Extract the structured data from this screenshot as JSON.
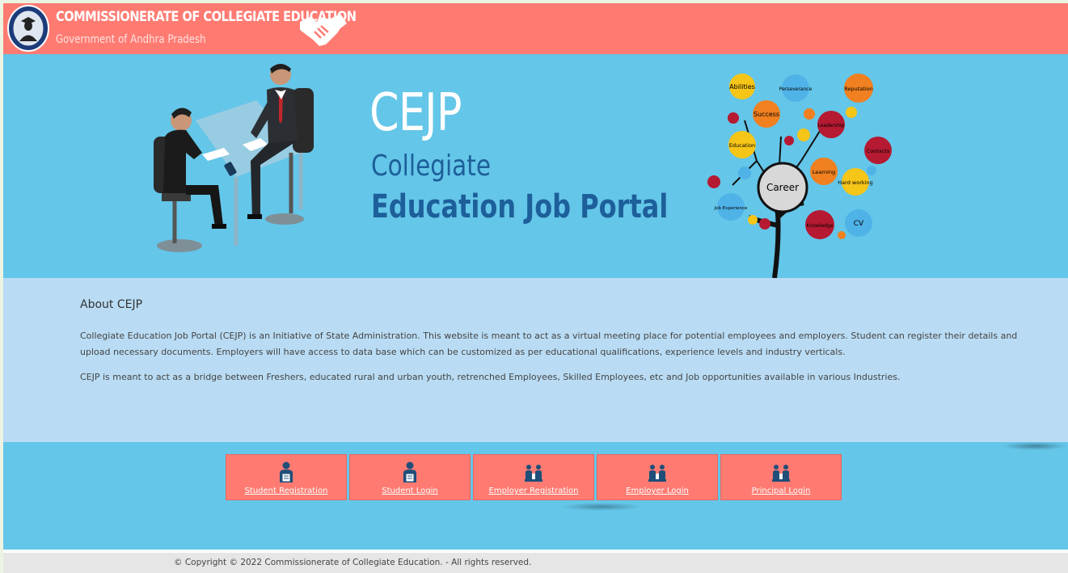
{
  "header": {
    "org_name": "COMMISSIONERATE OF COLLEGIATE EDUCATION",
    "org_subtitle": "Government of Andhra Pradesh"
  },
  "banner": {
    "title": "CEJP",
    "subtitle_line1": "Collegiate",
    "subtitle_line2": "Education Job Portal",
    "tree_words": [
      "Abilities",
      "Perseverance",
      "Reputation",
      "Success",
      "Leadership",
      "Education",
      "Contacts",
      "Career",
      "Learning",
      "Hard working",
      "Job Experience",
      "Knowledge",
      "CV"
    ]
  },
  "about": {
    "heading": "About CEJP",
    "paragraph1": "Collegiate Education Job Portal (CEJP) is an Initiative of State Administration. This website is meant to act as a virtual meeting place for potential employees and employers. Student can register their details and upload necessary documents. Employers will have access to data base which can be customized as per educational qualifications, experience levels and industry verticals.",
    "paragraph2": "CEJP is meant to act as a bridge between Freshers, educated rural and urban youth, retrenched Employees, Skilled Employees, etc and Job opportunities available in various Industries."
  },
  "buttons": [
    {
      "label": "Student Registration",
      "icon": "student-icon"
    },
    {
      "label": "Student Login",
      "icon": "student-icon"
    },
    {
      "label": "Employer Registration",
      "icon": "interview-icon"
    },
    {
      "label": "Employer Login",
      "icon": "interview-icon"
    },
    {
      "label": "Principal Login",
      "icon": "interview-icon"
    }
  ],
  "footer": {
    "copyright": "© Copyright © 2022 Commissionerate of Collegiate Education. - All rights reserved."
  },
  "colors": {
    "header_bg": "#ff7b72",
    "banner_bg": "#64c6e8",
    "about_bg": "#b9dcf4",
    "title_blue": "#1d5f9a"
  }
}
